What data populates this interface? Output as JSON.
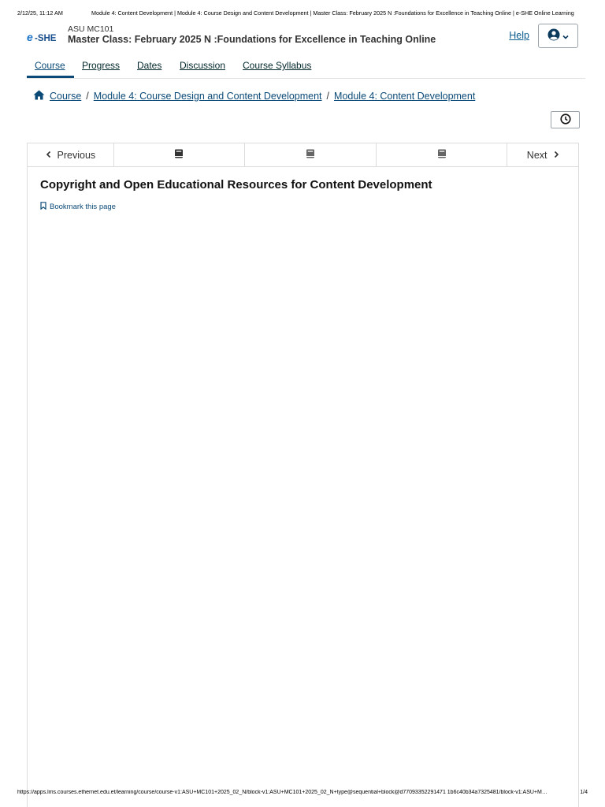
{
  "print_header": {
    "date": "2/12/25, 11:12 AM",
    "title": "Module 4: Content Development | Module 4: Course Design and Content Development | Master Class: February 2025 N :Foundations for Excellence in Teaching Online | e-SHE Online Learning"
  },
  "header": {
    "logo_text": "e-SHE",
    "course_org": "ASU MC101",
    "course_title": "Master Class: February 2025 N :Foundations for Excellence in Teaching Online",
    "help_label": "Help",
    "user_icon": "user-circle-icon"
  },
  "tabs": [
    {
      "label": "Course",
      "active": true
    },
    {
      "label": "Progress",
      "active": false
    },
    {
      "label": "Dates",
      "active": false
    },
    {
      "label": "Discussion",
      "active": false
    },
    {
      "label": "Course Syllabus",
      "active": false
    }
  ],
  "breadcrumb": {
    "home_icon": "home-icon",
    "items": [
      "Course",
      "Module 4: Course Design and Content Development",
      "Module 4: Content Development"
    ],
    "separator": "/"
  },
  "sequence_nav": {
    "previous_label": "Previous",
    "next_label": "Next",
    "unit_icons": [
      "book-icon",
      "book-icon",
      "book-icon"
    ]
  },
  "unit": {
    "title": "Copyright and Open Educational Resources for Content Development",
    "bookmark_label": "Bookmark this page"
  },
  "print_footer": {
    "url": "https://apps.lms.courses.ethernet.edu.et/learning/course/course-v1:ASU+MC101+2025_02_N/block-v1:ASU+MC101+2025_02_N+type@sequential+block@d77093352291471 1b6c40b34a7325481/block-v1:ASU+M…",
    "page": "1/4"
  },
  "colors": {
    "link": "#0b4a77",
    "logo_blue": "#1a73c8",
    "border": "#dcdcdc"
  }
}
